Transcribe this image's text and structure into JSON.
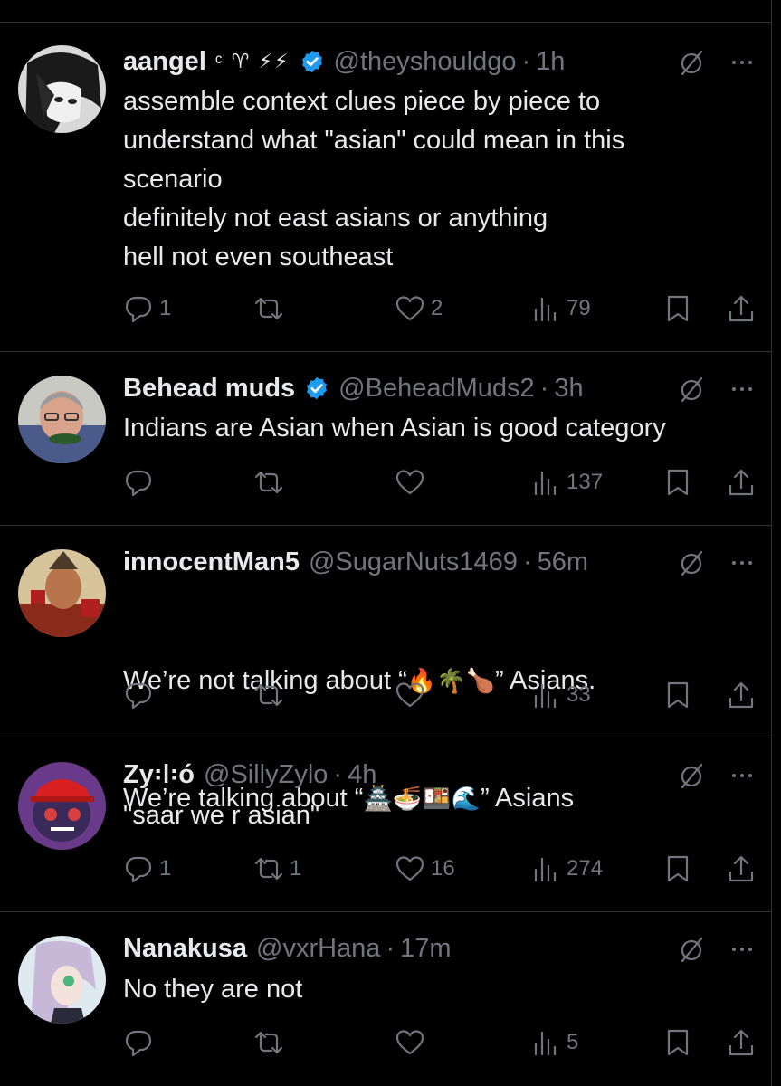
{
  "tweets": [
    {
      "name": "aangel",
      "badge": "ᶜ ♈ ⚡⚡",
      "handle": "@theyshouldgo",
      "time": "1h",
      "text": "assemble context clues piece by piece to\nunderstand what \"asian\" could mean in this\nscenario\ndefinitely not east asians or anything\nhell not even southeast",
      "replies": "1",
      "retweets": "",
      "likes": "2",
      "views": "79",
      "verified": true
    },
    {
      "name": "Behead muds",
      "badge": "",
      "handle": "@BeheadMuds2",
      "time": "3h",
      "text": "Indians are Asian when Asian is good category",
      "replies": "",
      "retweets": "",
      "likes": "",
      "views": "137",
      "verified": true
    },
    {
      "name": "innocentMan5",
      "badge": "",
      "handle": "@SugarNuts1469",
      "time": "56m",
      "text_line1_before": "We’re not talking about “",
      "text_line1_emoji": "🔥🌴🍗",
      "text_line1_after": "” Asians.",
      "text_line2_before": "We’re talking about “",
      "text_line2_emoji": "🏯🍜🍱🌊",
      "text_line2_after": "” Asians",
      "replies": "",
      "retweets": "",
      "likes": "",
      "views": "33",
      "verified": false
    },
    {
      "name": "Zy꞉ǀ꞉ó",
      "badge": "",
      "handle": "@SillyZylo",
      "time": "4h",
      "text": "\"saar we r asian\"",
      "replies": "1",
      "retweets": "1",
      "likes": "16",
      "views": "274",
      "verified": false
    },
    {
      "name": "Nanakusa",
      "badge": "",
      "handle": "@vxrHana",
      "time": "17m",
      "text": "No they are not",
      "replies": "",
      "retweets": "",
      "likes": "",
      "views": "5",
      "verified": false
    }
  ],
  "separator": "·",
  "icons": {
    "reply": "reply-icon",
    "retweet": "retweet-icon",
    "like": "heart-icon",
    "views": "views-icon",
    "bookmark": "bookmark-icon",
    "share": "share-icon",
    "grok": "grok-icon",
    "more": "more-icon",
    "verified": "verified-icon"
  },
  "colors": {
    "background": "#000000",
    "text": "#e7e9ea",
    "muted": "#71767b",
    "divider": "#2f3336",
    "verified": "#1d9bf0"
  }
}
